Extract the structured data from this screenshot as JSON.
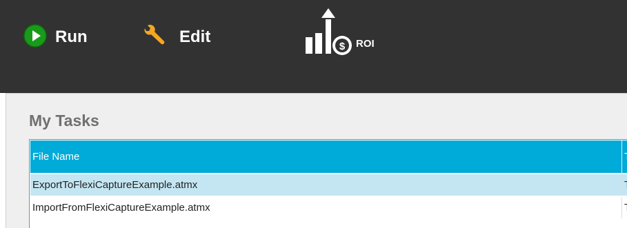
{
  "toolbar": {
    "run": {
      "label": "Run",
      "icon": "play-icon",
      "color": "#1a9a1a"
    },
    "edit": {
      "label": "Edit",
      "icon": "wrench-icon",
      "color": "#f5a623"
    },
    "roi": {
      "label": "ROI",
      "icon": "roi-chart-icon"
    }
  },
  "tasks": {
    "title": "My Tasks",
    "columns": [
      "File Name",
      "T"
    ],
    "rows": [
      {
        "file_name": "ExportToFlexiCaptureExample.atmx",
        "second": "T",
        "selected": true
      },
      {
        "file_name": "ImportFromFlexiCaptureExample.atmx",
        "second": "T",
        "selected": false
      }
    ]
  },
  "colors": {
    "toolbar_bg": "#323232",
    "header_bg": "#00aad9",
    "selected_row_bg": "#c4e6f2",
    "panel_bg": "#efefef"
  }
}
